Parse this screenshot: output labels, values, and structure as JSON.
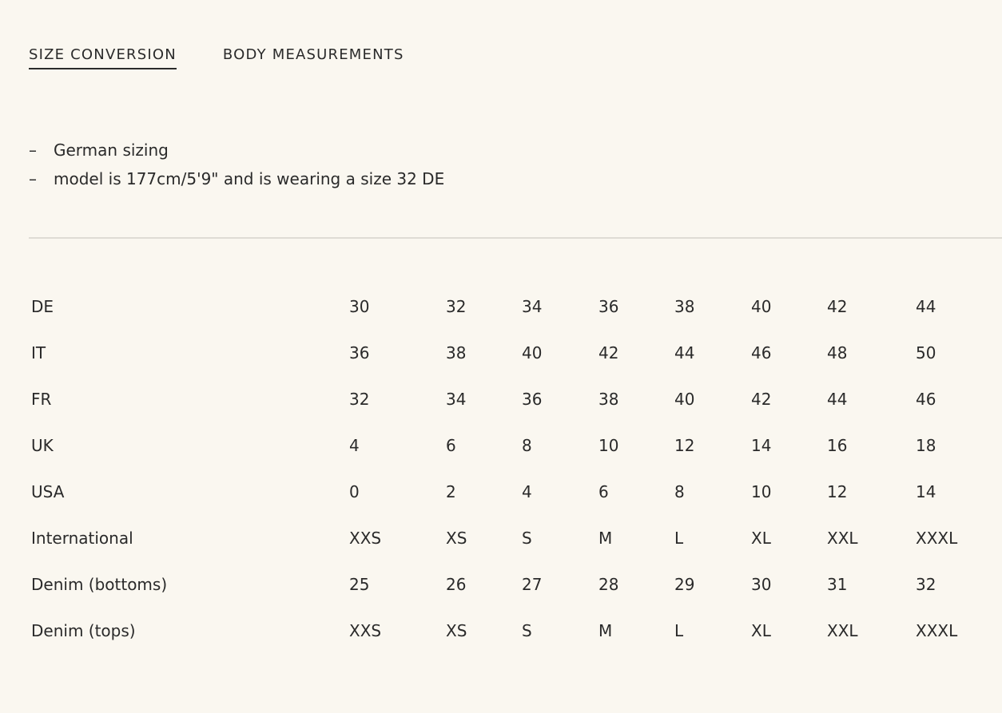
{
  "tabs": [
    {
      "label": "SIZE CONVERSION",
      "active": true
    },
    {
      "label": "BODY MEASUREMENTS",
      "active": false
    }
  ],
  "notes": [
    "German sizing",
    "model is 177cm/5'9\" and is wearing a size 32 DE"
  ],
  "size_table": {
    "rows": [
      {
        "label": "DE",
        "values": [
          "30",
          "32",
          "34",
          "36",
          "38",
          "40",
          "42",
          "44"
        ]
      },
      {
        "label": "IT",
        "values": [
          "36",
          "38",
          "40",
          "42",
          "44",
          "46",
          "48",
          "50"
        ]
      },
      {
        "label": "FR",
        "values": [
          "32",
          "34",
          "36",
          "38",
          "40",
          "42",
          "44",
          "46"
        ]
      },
      {
        "label": "UK",
        "values": [
          "4",
          "6",
          "8",
          "10",
          "12",
          "14",
          "16",
          "18"
        ]
      },
      {
        "label": "USA",
        "values": [
          "0",
          "2",
          "4",
          "6",
          "8",
          "10",
          "12",
          "14"
        ]
      },
      {
        "label": "International",
        "values": [
          "XXS",
          "XS",
          "S",
          "M",
          "L",
          "XL",
          "XXL",
          "XXXL"
        ]
      },
      {
        "label": "Denim (bottoms)",
        "values": [
          "25",
          "26",
          "27",
          "28",
          "29",
          "30",
          "31",
          "32"
        ]
      },
      {
        "label": "Denim (tops)",
        "values": [
          "XXS",
          "XS",
          "S",
          "M",
          "L",
          "XL",
          "XXL",
          "XXXL"
        ]
      }
    ]
  }
}
